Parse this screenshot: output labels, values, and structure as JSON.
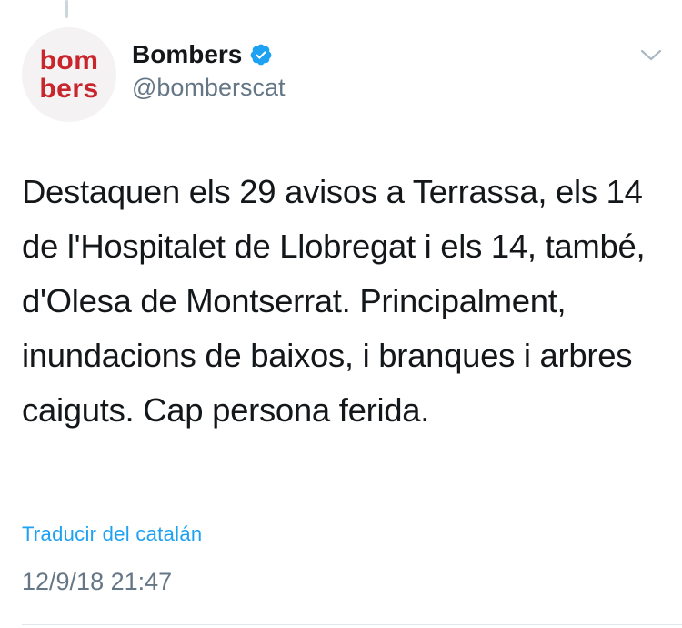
{
  "tweet": {
    "avatar": {
      "line1": "bom",
      "line2": "bers"
    },
    "display_name": "Bombers",
    "handle": "@bomberscat",
    "verified_icon": "verified-badge-icon",
    "menu_icon": "chevron-down-icon",
    "text": "Destaquen els 29 avisos a Terrassa, els 14 de l'Hospitalet de Llobregat i els 14, també, d'Olesa de Montserrat. Principalment, inundacions de baixos, i branques i arbres caiguts. Cap persona ferida.",
    "translate_label": "Traducir del catalán",
    "timestamp": "12/9/18 21:47"
  },
  "colors": {
    "brand_red": "#c8252c",
    "link_blue": "#1da1f2",
    "secondary_gray": "#657786",
    "verified_blue": "#1da1f2"
  }
}
